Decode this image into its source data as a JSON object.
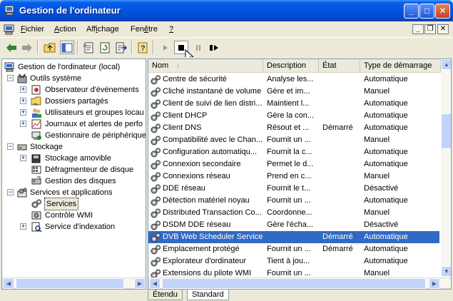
{
  "window": {
    "title": "Gestion de l'ordinateur",
    "buttons": {
      "minimize": "_",
      "maximize": "□",
      "close": "✕"
    }
  },
  "menu": {
    "items": [
      {
        "pre": "",
        "u": "F",
        "post": "ichier"
      },
      {
        "pre": "",
        "u": "A",
        "post": "ction"
      },
      {
        "pre": "Aff",
        "u": "i",
        "post": "chage"
      },
      {
        "pre": "Fen",
        "u": "ê",
        "post": "tre"
      },
      {
        "pre": "",
        "u": "?",
        "post": ""
      }
    ],
    "mdi": {
      "minimize": "_",
      "restore": "❐",
      "close": "✕"
    }
  },
  "toolbar": {
    "icons": [
      "back-arrow-icon",
      "forward-arrow-icon",
      "up-folder-icon",
      "show-hide-tree-icon",
      "properties-icon",
      "refresh-icon",
      "export-list-icon",
      "help-icon",
      "start-service-icon",
      "stop-service-icon",
      "pause-service-icon",
      "restart-service-icon"
    ]
  },
  "tree": {
    "items": [
      {
        "label": "Gestion de l'ordinateur (local)",
        "level": 0,
        "expander": "",
        "icon": "computer-icon"
      },
      {
        "label": "Outils système",
        "level": 1,
        "expander": "−",
        "icon": "tools-icon"
      },
      {
        "label": "Observateur d'événements",
        "level": 2,
        "expander": "+",
        "icon": "event-viewer-icon"
      },
      {
        "label": "Dossiers partagés",
        "level": 2,
        "expander": "+",
        "icon": "shared-folder-icon"
      },
      {
        "label": "Utilisateurs et groupes locau",
        "level": 2,
        "expander": "+",
        "icon": "users-icon"
      },
      {
        "label": "Journaux et alertes de perfo",
        "level": 2,
        "expander": "+",
        "icon": "perf-logs-icon"
      },
      {
        "label": "Gestionnaire de périphérique",
        "level": 2,
        "expander": "",
        "icon": "device-manager-icon"
      },
      {
        "label": "Stockage",
        "level": 1,
        "expander": "−",
        "icon": "storage-icon"
      },
      {
        "label": "Stockage amovible",
        "level": 2,
        "expander": "+",
        "icon": "removable-storage-icon"
      },
      {
        "label": "Défragmenteur de disque",
        "level": 2,
        "expander": "",
        "icon": "defrag-icon"
      },
      {
        "label": "Gestion des disques",
        "level": 2,
        "expander": "",
        "icon": "disk-management-icon"
      },
      {
        "label": "Services et applications",
        "level": 1,
        "expander": "−",
        "icon": "services-apps-icon"
      },
      {
        "label": "Services",
        "level": 2,
        "expander": "",
        "icon": "services-icon",
        "selected": true
      },
      {
        "label": "Contrôle WMI",
        "level": 2,
        "expander": "",
        "icon": "wmi-icon"
      },
      {
        "label": "Service d'indexation",
        "level": 2,
        "expander": "+",
        "icon": "indexing-icon"
      }
    ]
  },
  "list": {
    "columns": {
      "name": "Nom",
      "sort": "/",
      "description": "Description",
      "state": "État",
      "startup": "Type de démarrage"
    },
    "rows": [
      {
        "name": "Centre de sécurité",
        "description": "Analyse les...",
        "state": "",
        "startup": "Automatique"
      },
      {
        "name": "Cliché instantané de volume",
        "description": "Gère et im...",
        "state": "",
        "startup": "Manuel"
      },
      {
        "name": "Client de suivi de lien distri...",
        "description": "Maintient l...",
        "state": "",
        "startup": "Automatique"
      },
      {
        "name": "Client DHCP",
        "description": "Gère la con...",
        "state": "",
        "startup": "Automatique"
      },
      {
        "name": "Client DNS",
        "description": "Résout et ...",
        "state": "Démarré",
        "startup": "Automatique"
      },
      {
        "name": "Compatibilité avec le Chan...",
        "description": "Fournit un ...",
        "state": "",
        "startup": "Manuel"
      },
      {
        "name": "Configuration automatiqu...",
        "description": "Fournit la c...",
        "state": "",
        "startup": "Automatique"
      },
      {
        "name": "Connexion secondaire",
        "description": "Permet le d...",
        "state": "",
        "startup": "Automatique"
      },
      {
        "name": "Connexions réseau",
        "description": "Prend en c...",
        "state": "",
        "startup": "Manuel"
      },
      {
        "name": "DDE réseau",
        "description": "Fournit le t...",
        "state": "",
        "startup": "Désactivé"
      },
      {
        "name": "Détection matériel noyau",
        "description": "Fournit un ...",
        "state": "",
        "startup": "Automatique"
      },
      {
        "name": "Distributed Transaction Co...",
        "description": "Coordonne...",
        "state": "",
        "startup": "Manuel"
      },
      {
        "name": "DSDM DDE réseau",
        "description": "Gère l'écha...",
        "state": "",
        "startup": "Désactivé"
      },
      {
        "name": "DVB Web Scheduler Service",
        "description": "",
        "state": "Démarré",
        "startup": "Automatique",
        "selected": true
      },
      {
        "name": "Emplacement protégé",
        "description": "Fournit un ...",
        "state": "Démarré",
        "startup": "Automatique"
      },
      {
        "name": "Explorateur d'ordinateur",
        "description": "Tient à jou...",
        "state": "",
        "startup": "Automatique"
      },
      {
        "name": "Extensions du pilote WMI",
        "description": "Fournit un ...",
        "state": "",
        "startup": "Manuel"
      }
    ]
  },
  "tabs": [
    {
      "label": "Étendu"
    },
    {
      "label": "Standard",
      "active": true
    }
  ],
  "colors": {
    "selection": "#316ac5",
    "titlebar": "#0054e3"
  }
}
